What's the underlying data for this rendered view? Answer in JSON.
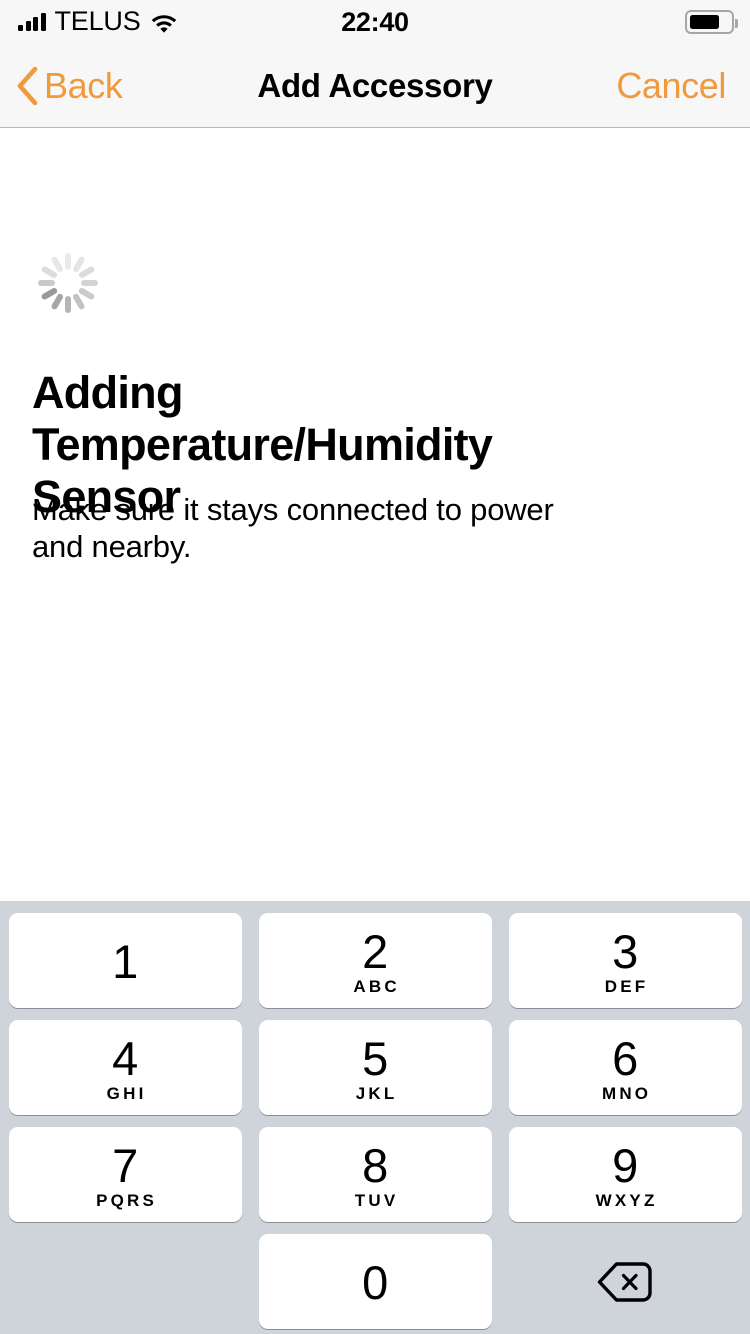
{
  "status_bar": {
    "carrier": "TELUS",
    "time": "22:40",
    "signal_bars": 4,
    "wifi_icon": "wifi-icon",
    "battery_level_percent": 70,
    "battery_icon": "battery-icon"
  },
  "nav_bar": {
    "back_label": "Back",
    "back_icon": "chevron-left-icon",
    "title": "Add Accessory",
    "cancel_label": "Cancel",
    "accent_color": "#EF9A3D"
  },
  "content": {
    "spinner_icon": "activity-spinner-icon",
    "headline": "Adding Temperature/Humidity Sensor",
    "subcopy": "Make sure it stays connected to power and nearby."
  },
  "keypad": {
    "background_color": "#CFD4DA",
    "key_color": "#FFFFFF",
    "delete_icon": "backspace-icon",
    "rows": [
      [
        {
          "digit": "1",
          "letters": ""
        },
        {
          "digit": "2",
          "letters": "ABC"
        },
        {
          "digit": "3",
          "letters": "DEF"
        }
      ],
      [
        {
          "digit": "4",
          "letters": "GHI"
        },
        {
          "digit": "5",
          "letters": "JKL"
        },
        {
          "digit": "6",
          "letters": "MNO"
        }
      ],
      [
        {
          "digit": "7",
          "letters": "PQRS"
        },
        {
          "digit": "8",
          "letters": "TUV"
        },
        {
          "digit": "9",
          "letters": "WXYZ"
        }
      ],
      [
        {
          "digit": "",
          "letters": ""
        },
        {
          "digit": "0",
          "letters": ""
        },
        {
          "digit": "delete",
          "letters": ""
        }
      ]
    ]
  }
}
